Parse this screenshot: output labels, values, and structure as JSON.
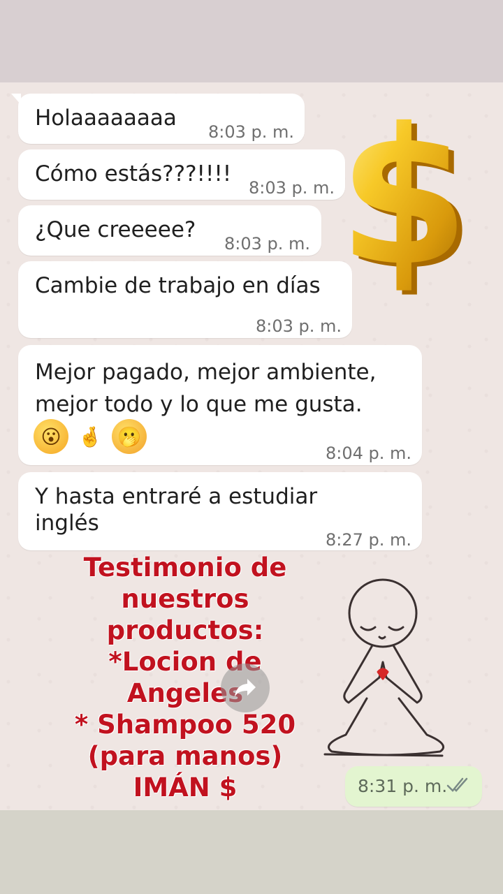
{
  "messages": [
    {
      "text": "Holaaaaaaaa",
      "time": "8:03 p. m."
    },
    {
      "text": "Cómo estás???!!!!",
      "time": "8:03 p. m."
    },
    {
      "text": "¿Que creeeee?",
      "time": "8:03 p. m."
    },
    {
      "text": "Cambie de trabajo en días",
      "time": "8:03 p. m."
    },
    {
      "text": "Mejor pagado, mejor ambiente,\nmejor todo y lo que me gusta.",
      "time": "8:04 p. m."
    },
    {
      "text": "Y hasta entraré a estudiar\ninglés",
      "time": "8:27 p. m."
    }
  ],
  "emojis": [
    {
      "icon": "astonished-face-icon",
      "glyph": "😮"
    },
    {
      "icon": "crossed-fingers-icon",
      "glyph": "🤞"
    },
    {
      "icon": "face-with-hand-over-mouth-icon",
      "glyph": "🫢"
    }
  ],
  "promo": {
    "lines": [
      "Testimonio de",
      "nuestros",
      "productos:",
      "*Locion de",
      "Angeles",
      "* Shampoo 520",
      "(para manos)",
      "IMÁN $"
    ]
  },
  "outgoing": {
    "time": "8:31 p. m.",
    "status_icon": "double-check-icon"
  },
  "colors": {
    "promo_text": "#c1121f",
    "incoming_bubble": "#ffffff",
    "outgoing_bubble": "#e3f5d0",
    "chat_background": "#efe6e3"
  }
}
